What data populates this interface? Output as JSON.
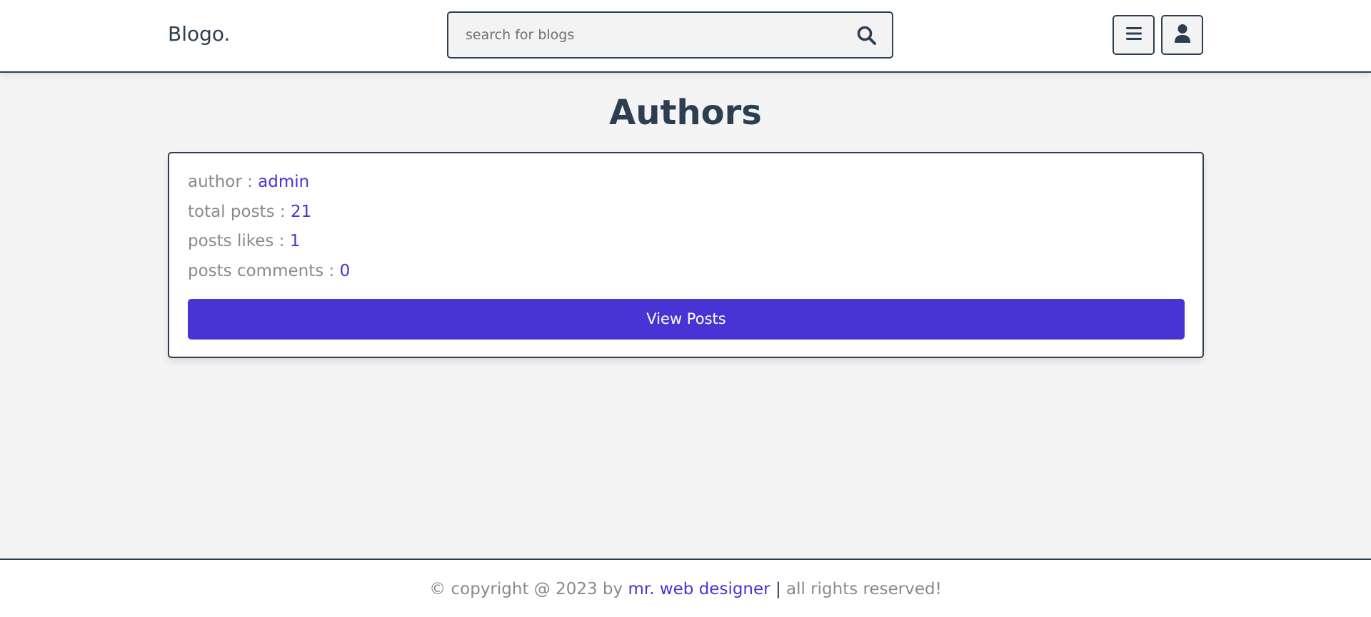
{
  "header": {
    "logo": "Blogo.",
    "search_placeholder": "search for blogs",
    "icons": {
      "search": "search-icon",
      "menu": "bars-icon",
      "user": "user-icon"
    }
  },
  "main": {
    "title": "Authors",
    "card": {
      "author_label": "author : ",
      "author_value": "admin",
      "total_posts_label": "total posts : ",
      "total_posts_value": "21",
      "likes_label": "posts likes : ",
      "likes_value": "1",
      "comments_label": "posts comments : ",
      "comments_value": "0",
      "button_label": "View Posts"
    }
  },
  "footer": {
    "prefix": "© copyright @ 2023 by ",
    "link": "mr. web designer",
    "separator": "|",
    "suffix": " all rights reserved!"
  },
  "colors": {
    "primary": "#2c3e50",
    "accent": "#4834d4",
    "muted": "#8a8a8a",
    "background": "#f4f4f4"
  }
}
